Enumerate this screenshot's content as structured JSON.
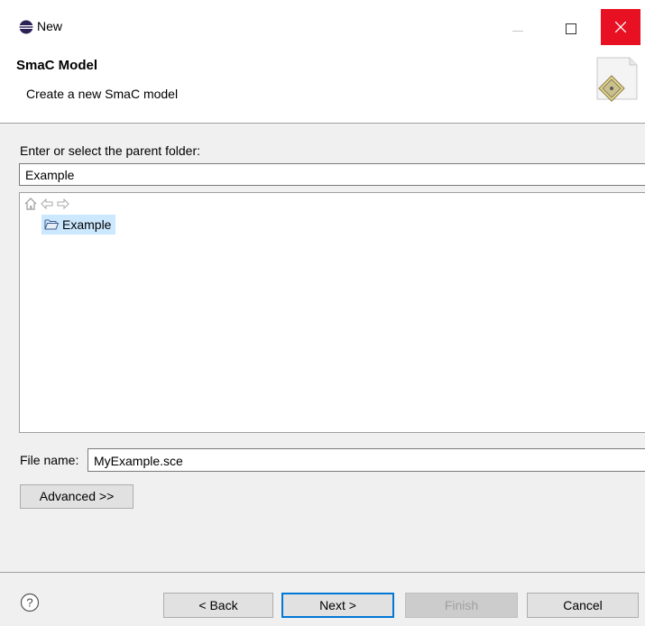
{
  "window": {
    "title": "New",
    "icon": "eclipse-icon"
  },
  "header": {
    "title": "SmaC Model",
    "description": "Create a new SmaC model",
    "banner_icon": "wizard-banner-icon"
  },
  "folder": {
    "label": "Enter or select the parent folder:",
    "value": "Example"
  },
  "tree": {
    "toolbar_icons": [
      "home-icon",
      "back-arrow-icon",
      "forward-arrow-icon"
    ],
    "items": [
      {
        "label": "Example",
        "icon": "open-folder-icon",
        "selected": true
      }
    ]
  },
  "file": {
    "label": "File name:",
    "value": "MyExample.sce"
  },
  "advanced_button": "Advanced >>",
  "footer": {
    "help_icon": "help-icon",
    "back": "< Back",
    "next": "Next >",
    "finish": "Finish",
    "cancel": "Cancel"
  },
  "colors": {
    "accent": "#0078d7",
    "close_hover": "#e81123",
    "selection": "#cce8ff",
    "dialog_bg": "#f0f0f0"
  }
}
